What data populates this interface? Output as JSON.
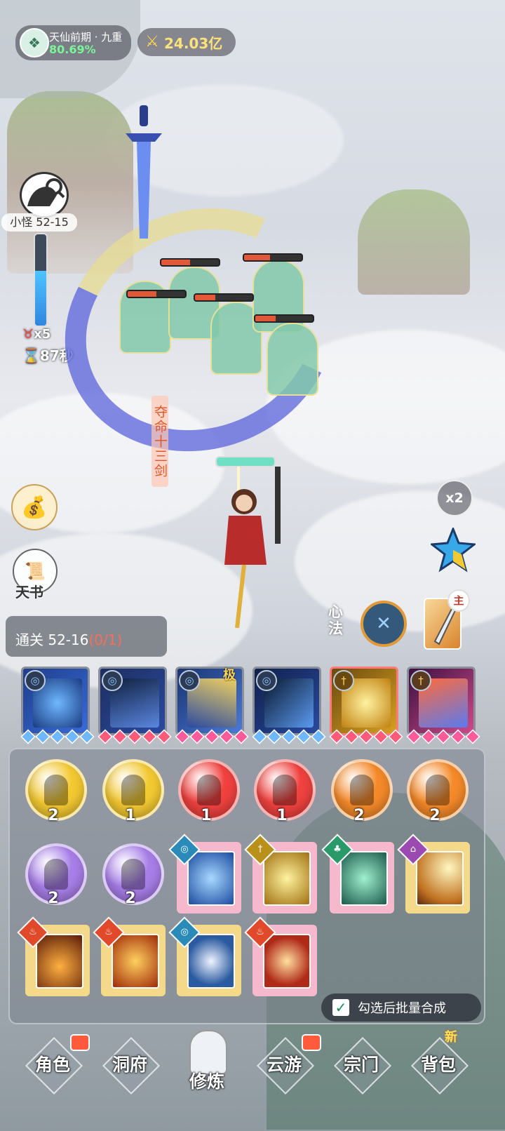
{
  "hud": {
    "realm_name": "天仙前期 · 九重",
    "realm_progress": "80.69%",
    "power": "24.03亿"
  },
  "stage": {
    "label": "小怪 52-15",
    "progress_fraction": 0.6,
    "multiplier": "x5",
    "timer": "87秒"
  },
  "battle": {
    "skill_name": "夺命十三剑",
    "enemy_hp_fractions": [
      0.5,
      0.45,
      0.5,
      0.35,
      0.35
    ],
    "player_hp_fraction": 1.0
  },
  "side": {
    "book_label": "天书",
    "speed_label": "x2"
  },
  "xinfa": {
    "label": "心法",
    "main_tag": "主"
  },
  "clear": {
    "label": "通关 52-16",
    "progress": "(0/1)"
  },
  "equipped_skills": [
    {
      "element_icon": "water-swirl-icon",
      "gem_color": "#6fb8ff"
    },
    {
      "element_icon": "water-swirl-icon",
      "gem_color": "#ff5a7a"
    },
    {
      "element_icon": "water-swirl-icon",
      "gem_color": "#ff5a9a",
      "tag": "极"
    },
    {
      "element_icon": "water-swirl-icon",
      "gem_color": "#6fb8ff"
    },
    {
      "element_icon": "metal-sword-icon",
      "gem_color": "#ff5a7a"
    },
    {
      "element_icon": "metal-sword-icon",
      "gem_color": "#ff5a9a"
    }
  ],
  "inventory": {
    "orbs": [
      {
        "color": "#f3c932",
        "count": "2"
      },
      {
        "color": "#f3c932",
        "count": "1"
      },
      {
        "color": "#f0423f",
        "count": "1"
      },
      {
        "color": "#f0423f",
        "count": "1"
      },
      {
        "color": "#f58a2a",
        "count": "2"
      },
      {
        "color": "#f58a2a",
        "count": "2"
      },
      {
        "color": "#a87ee8",
        "count": "2"
      },
      {
        "color": "#a87ee8",
        "count": "2"
      }
    ],
    "batch_label": "勾选后批量合成"
  },
  "nav": {
    "items": [
      {
        "label": "角色"
      },
      {
        "label": "洞府"
      },
      {
        "label": "修炼"
      },
      {
        "label": "云游"
      },
      {
        "label": "宗门"
      },
      {
        "label": "背包"
      }
    ],
    "new_badge": "新"
  }
}
